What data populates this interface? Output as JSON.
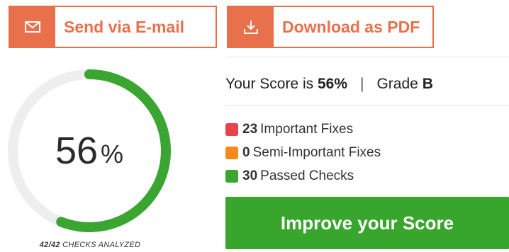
{
  "actions": {
    "email_label": "Send via E-mail",
    "pdf_label": "Download as PDF"
  },
  "score": {
    "percent": 56,
    "percent_text": "56",
    "percent_sign": "%",
    "score_prefix": "Your Score is",
    "score_value": "56%",
    "grade_prefix": "Grade",
    "grade_value": "B",
    "separator": "|"
  },
  "checks": {
    "analyzed_count": "42/42",
    "analyzed_label": "CHECKS ANALYZED"
  },
  "legend": [
    {
      "count": "23",
      "label": "Important Fixes",
      "color": "#e8434a"
    },
    {
      "count": "0",
      "label": "Semi-Important Fixes",
      "color": "#f48a1c"
    },
    {
      "count": "30",
      "label": "Passed Checks",
      "color": "#3aa531"
    }
  ],
  "improve": {
    "label": "Improve your Score"
  },
  "colors": {
    "accent": "#e8714c",
    "gauge_fill": "#3aa531",
    "gauge_track": "#eeeeee",
    "button_green": "#38a52c"
  }
}
